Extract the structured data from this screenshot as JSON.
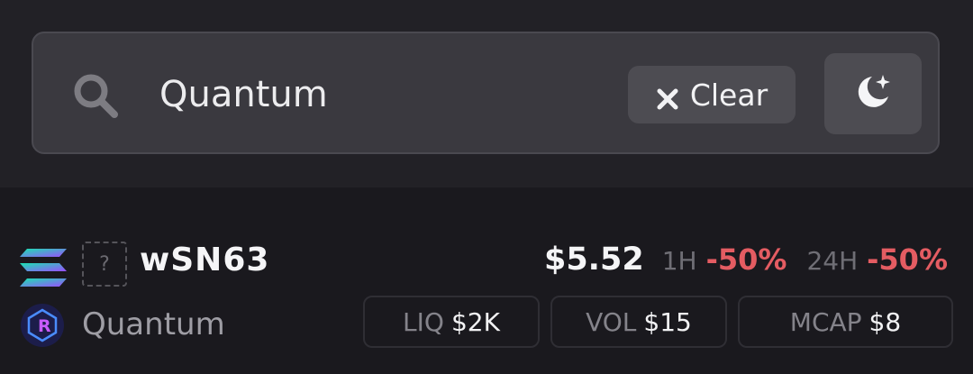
{
  "search": {
    "value": "Quantum",
    "clear_label": "Clear",
    "theme_icon": "moon-star-icon"
  },
  "result": {
    "chain_icon": "solana-icon",
    "placeholder_glyph": "?",
    "symbol": "wSN63",
    "dex_icon": "raydium-icon",
    "name": "Quantum",
    "price": "$5.52",
    "change_1h_label": "1H",
    "change_1h": "-50%",
    "change_24h_label": "24H",
    "change_24h": "-50%",
    "stats": {
      "liq_label": "LIQ",
      "liq_value": "$2K",
      "vol_label": "VOL",
      "vol_value": "$15",
      "mcap_label": "MCAP",
      "mcap_value": "$8"
    }
  },
  "colors": {
    "negative": "#e45c62",
    "background": "#1a191e",
    "search_bg": "#3a393f"
  }
}
